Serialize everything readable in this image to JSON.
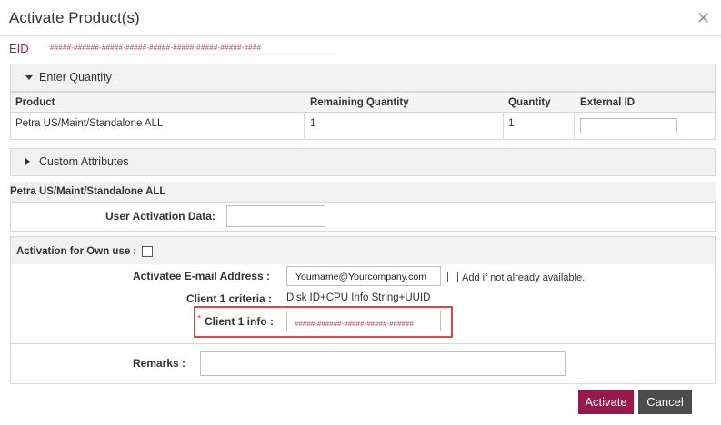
{
  "dialog": {
    "title": "Activate Product(s)",
    "close_icon": "close-icon"
  },
  "eid": {
    "label": "EID",
    "value": "#####-######-#####-#####-#####-#####-#####-#####-####"
  },
  "enter_quantity": {
    "label": "Enter Quantity",
    "headers": [
      "Product",
      "Remaining Quantity",
      "Quantity",
      "External ID"
    ],
    "row": {
      "product": "Petra US/Maint/Standalone ALL",
      "remaining": "1",
      "quantity": "1",
      "external_id": ""
    }
  },
  "custom_attributes": {
    "label": "Custom Attributes"
  },
  "product_section": {
    "title": "Petra US/Maint/Standalone ALL",
    "user_activation_label": "User Activation Data:",
    "user_activation_value": ""
  },
  "own_use": {
    "label": "Activation for Own use :",
    "checked": false
  },
  "activatee": {
    "label": "Activatee E-mail Address :",
    "value": "Yourname@Yourcompany.com",
    "add_label": "Add if not already available."
  },
  "client_criteria": {
    "label": "Client 1 criteria :",
    "value": "Disk ID+CPU Info String+UUID"
  },
  "client_info": {
    "required_mark": "*",
    "label": "Client 1 info :",
    "value": "#####-######-#####-#####-######"
  },
  "remarks": {
    "label": "Remarks :",
    "value": ""
  },
  "buttons": {
    "activate": "Activate",
    "cancel": "Cancel"
  },
  "colors": {
    "accent": "#98184e",
    "eid_label": "#a3195b",
    "highlight": "#e04848"
  }
}
